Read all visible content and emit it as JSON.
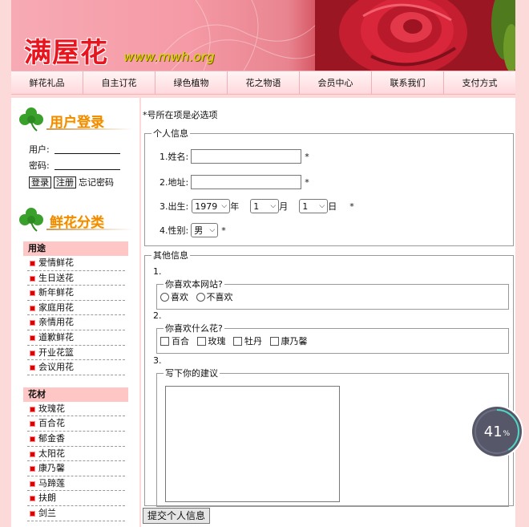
{
  "header": {
    "logo_cn": "满屋花",
    "logo_en": "www.mwh.org"
  },
  "nav": [
    "鲜花礼品",
    "自主订花",
    "绿色植物",
    "花之物语",
    "会员中心",
    "联系我们",
    "支付方式"
  ],
  "sidebar": {
    "login_title": "用户登录",
    "user_label": "用户:",
    "password_label": "密码:",
    "login_button": "登录",
    "register_button": "注册",
    "forgot_link": "忘记密码",
    "category_title": "鲜花分类",
    "sections": [
      {
        "heading": "用途",
        "items": [
          "爱情鲜花",
          "生日送花",
          "新年鲜花",
          "家庭用花",
          "亲情用花",
          "道歉鲜花",
          "开业花篮",
          "会议用花"
        ]
      },
      {
        "heading": "花材",
        "items": [
          "玫瑰花",
          "百合花",
          "郁金香",
          "太阳花",
          "康乃馨",
          "马蹄莲",
          "扶朗",
          "剑兰"
        ]
      }
    ]
  },
  "form": {
    "required_note": "*号所在项是必选项",
    "personal_legend": "个人信息",
    "name_label": "1.姓名:",
    "address_label": "2.地址:",
    "birth_label": "3.出生:",
    "birth_year": "1979",
    "year_unit": "年",
    "birth_month": "1",
    "month_unit": "月",
    "birth_day": "1",
    "day_unit": "日",
    "gender_label": "4.性别:",
    "gender_value": "男",
    "star": "*",
    "other_legend": "其他信息",
    "q1_num": "1.",
    "q1_legend": "你喜欢本网站?",
    "q1_options": [
      "喜欢",
      "不喜欢"
    ],
    "q2_num": "2.",
    "q2_legend": "你喜欢什么花?",
    "q2_options": [
      "百合",
      "玫瑰",
      "牡丹",
      "康乃馨"
    ],
    "q3_num": "3.",
    "q3_legend": "写下你的建议",
    "submit_label": "提交个人信息"
  },
  "progress_widget": {
    "value": "41",
    "unit": "%",
    "fraction": 0.41
  }
}
